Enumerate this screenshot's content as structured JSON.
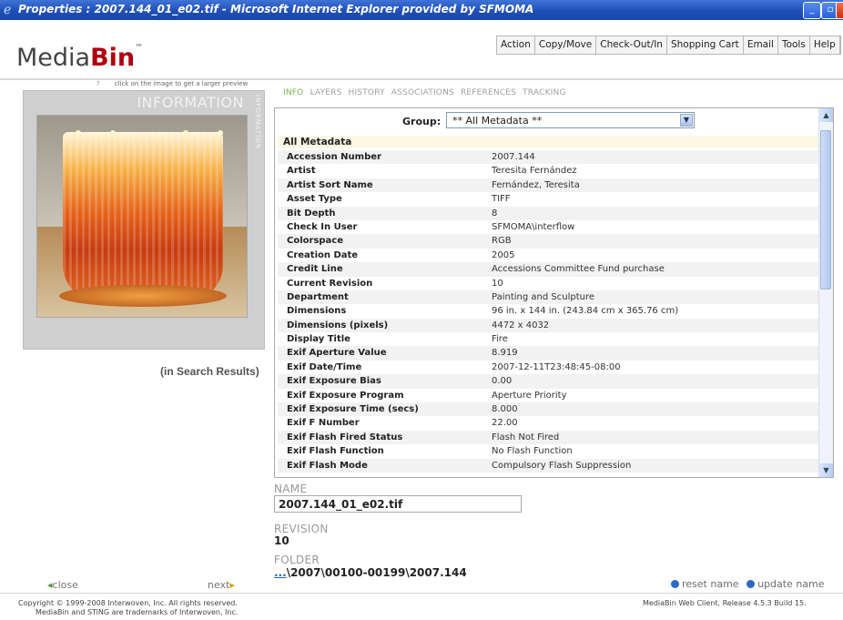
{
  "window": {
    "title": "Properties : 2007.144_01_e02.tif - Microsoft Internet Explorer provided by SFMOMA",
    "icon": "ie-icon"
  },
  "brand": {
    "logo_light": "Media",
    "logo_bold": "Bin",
    "tm": "™"
  },
  "toolbar": {
    "items": [
      "Action",
      "Copy/Move",
      "Check-Out/In",
      "Shopping Cart",
      "Email",
      "Tools",
      "Help"
    ]
  },
  "left_panel": {
    "hint": "click on the image to get a larger preview",
    "panel_title": "INFORMATION",
    "vertical_label": "INFORMATION",
    "in_search": "(in Search Results)",
    "close_label": "close",
    "next_label": "next"
  },
  "tabs": [
    "INFO",
    "LAYERS",
    "HISTORY",
    "ASSOCIATIONS",
    "REFERENCES",
    "TRACKING"
  ],
  "metadata": {
    "group_label": "Group:",
    "group_value": "** All Metadata **",
    "section_title": "All Metadata",
    "rows": [
      {
        "key": "Accession Number",
        "value": "2007.144"
      },
      {
        "key": "Artist",
        "value": "Teresita Fernández"
      },
      {
        "key": "Artist Sort Name",
        "value": "Fernández, Teresita"
      },
      {
        "key": "Asset Type",
        "value": "TIFF"
      },
      {
        "key": "Bit Depth",
        "value": "8"
      },
      {
        "key": "Check In User",
        "value": "SFMOMA\\interflow"
      },
      {
        "key": "Colorspace",
        "value": "RGB"
      },
      {
        "key": "Creation Date",
        "value": "2005"
      },
      {
        "key": "Credit Line",
        "value": "Accessions Committee Fund purchase"
      },
      {
        "key": "Current Revision",
        "value": "10"
      },
      {
        "key": "Department",
        "value": "Painting and Sculpture"
      },
      {
        "key": "Dimensions",
        "value": "96 in. x 144 in. (243.84 cm x 365.76 cm)"
      },
      {
        "key": "Dimensions (pixels)",
        "value": "4472 x 4032"
      },
      {
        "key": "Display Title",
        "value": "Fire"
      },
      {
        "key": "Exif Aperture Value",
        "value": "8.919"
      },
      {
        "key": "Exif Date/Time",
        "value": "2007-12-11T23:48:45-08:00"
      },
      {
        "key": "Exif Exposure Bias",
        "value": "0.00"
      },
      {
        "key": "Exif Exposure Program",
        "value": "Aperture Priority"
      },
      {
        "key": "Exif Exposure Time (secs)",
        "value": "8.000"
      },
      {
        "key": "Exif F Number",
        "value": "22.00"
      },
      {
        "key": "Exif Flash Fired Status",
        "value": "Flash Not Fired"
      },
      {
        "key": "Exif Flash Function",
        "value": "No Flash Function"
      },
      {
        "key": "Exif Flash Mode",
        "value": "Compulsory Flash Suppression"
      }
    ]
  },
  "fields": {
    "name_label": "NAME",
    "name_value": "2007.144_01_e02.tif",
    "revision_label": "REVISION",
    "revision_value": "10",
    "folder_label": "FOLDER",
    "folder_dots": "...",
    "folder_value": "\\2007\\00100-00199\\2007.144"
  },
  "actions": {
    "reset": "reset name",
    "update": "update name"
  },
  "footer": {
    "copyright": "Copyright © 1999-2008 Interwoven, Inc. All rights reserved.",
    "trademark": "MediaBin and STiNG are trademarks of Interwoven, Inc.",
    "release": "MediaBin Web Client, Release 4.5.3 Build 15."
  }
}
